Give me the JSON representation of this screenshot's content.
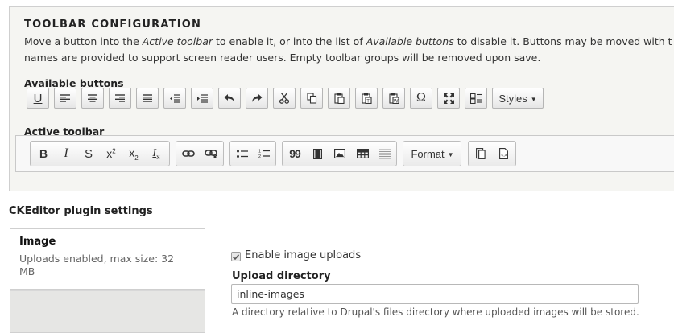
{
  "toolbar_config": {
    "legend": "TOOLBAR CONFIGURATION",
    "desc_line1_a": "Move a button into the ",
    "desc_line1_em1": "Active toolbar",
    "desc_line1_b": " to enable it, or into the list of ",
    "desc_line1_em2": "Available buttons",
    "desc_line1_c": " to disable it. Buttons may be moved with t",
    "desc_line2": "names are provided to support screen reader users. Empty toolbar groups will be removed upon save.",
    "available_label": "Available buttons",
    "active_label": "Active toolbar",
    "available_buttons": [
      {
        "icon": "underline-icon",
        "glyph": "U"
      },
      {
        "icon": "align-left-icon"
      },
      {
        "icon": "align-center-icon"
      },
      {
        "icon": "align-right-icon"
      },
      {
        "icon": "justify-icon"
      },
      {
        "icon": "outdent-icon"
      },
      {
        "icon": "indent-icon"
      },
      {
        "icon": "undo-icon"
      },
      {
        "icon": "redo-icon"
      },
      {
        "icon": "cut-icon"
      },
      {
        "icon": "copy-icon"
      },
      {
        "icon": "paste-icon"
      },
      {
        "icon": "paste-text-icon"
      },
      {
        "icon": "paste-word-icon"
      },
      {
        "icon": "special-char-icon",
        "glyph": "Ω"
      },
      {
        "icon": "maximize-icon"
      },
      {
        "icon": "show-blocks-icon"
      }
    ],
    "styles_label": "Styles",
    "active_toolbar": {
      "group1": [
        {
          "icon": "bold-icon",
          "glyph": "B"
        },
        {
          "icon": "italic-icon",
          "glyph": "I"
        },
        {
          "icon": "strikethrough-icon",
          "glyph": "S"
        },
        {
          "icon": "superscript-icon",
          "glyph": "x²"
        },
        {
          "icon": "subscript-icon",
          "glyph": "x₂"
        },
        {
          "icon": "remove-format-icon",
          "glyph": "Ix"
        }
      ],
      "group2": [
        {
          "icon": "link-icon"
        },
        {
          "icon": "unlink-icon"
        }
      ],
      "group3": [
        {
          "icon": "bulleted-list-icon"
        },
        {
          "icon": "numbered-list-icon"
        }
      ],
      "group4": [
        {
          "icon": "blockquote-icon",
          "glyph": "99"
        },
        {
          "icon": "media-icon"
        },
        {
          "icon": "image-icon"
        },
        {
          "icon": "table-icon"
        },
        {
          "icon": "horizontal-line-icon"
        }
      ],
      "format_label": "Format",
      "group6": [
        {
          "icon": "source-icon"
        },
        {
          "icon": "source-code-icon"
        }
      ]
    }
  },
  "plugin_settings": {
    "title": "CKEditor plugin settings",
    "tab_title": "Image",
    "tab_summary": "Uploads enabled, max size: 32 MB",
    "enable_label": "Enable image uploads",
    "enable_checked": true,
    "dir_label": "Upload directory",
    "dir_value": "inline-images",
    "dir_desc": "A directory relative to Drupal's files directory where uploaded images will be stored."
  }
}
